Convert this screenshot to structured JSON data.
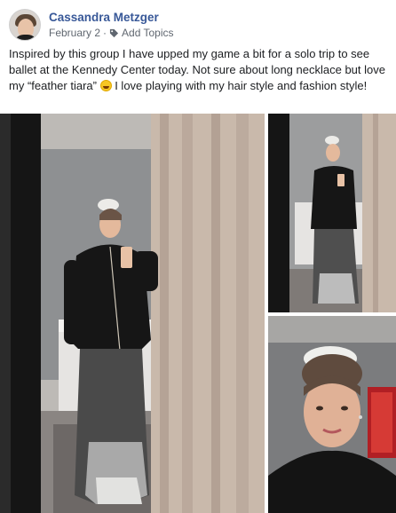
{
  "post": {
    "author": "Cassandra Metzger",
    "date": "February 2",
    "separator": "·",
    "topics_label": "Add Topics",
    "text_before_emoji": "Inspired by this group I have upped my game a bit for a solo trip to see ballet at the Kennedy Center today. Not sure about long necklace but love my “feather tiara” ",
    "text_after_emoji": " I love playing with my hair style and fashion style!",
    "emoji": "laughing-crying-emoji",
    "avatar": "profile-photo",
    "icons": {
      "topics": "tag-icon"
    }
  },
  "photos": [
    {
      "name": "mirror-selfie-full-length"
    },
    {
      "name": "mirror-selfie-small"
    },
    {
      "name": "closeup-selfie-feather-tiara"
    }
  ]
}
